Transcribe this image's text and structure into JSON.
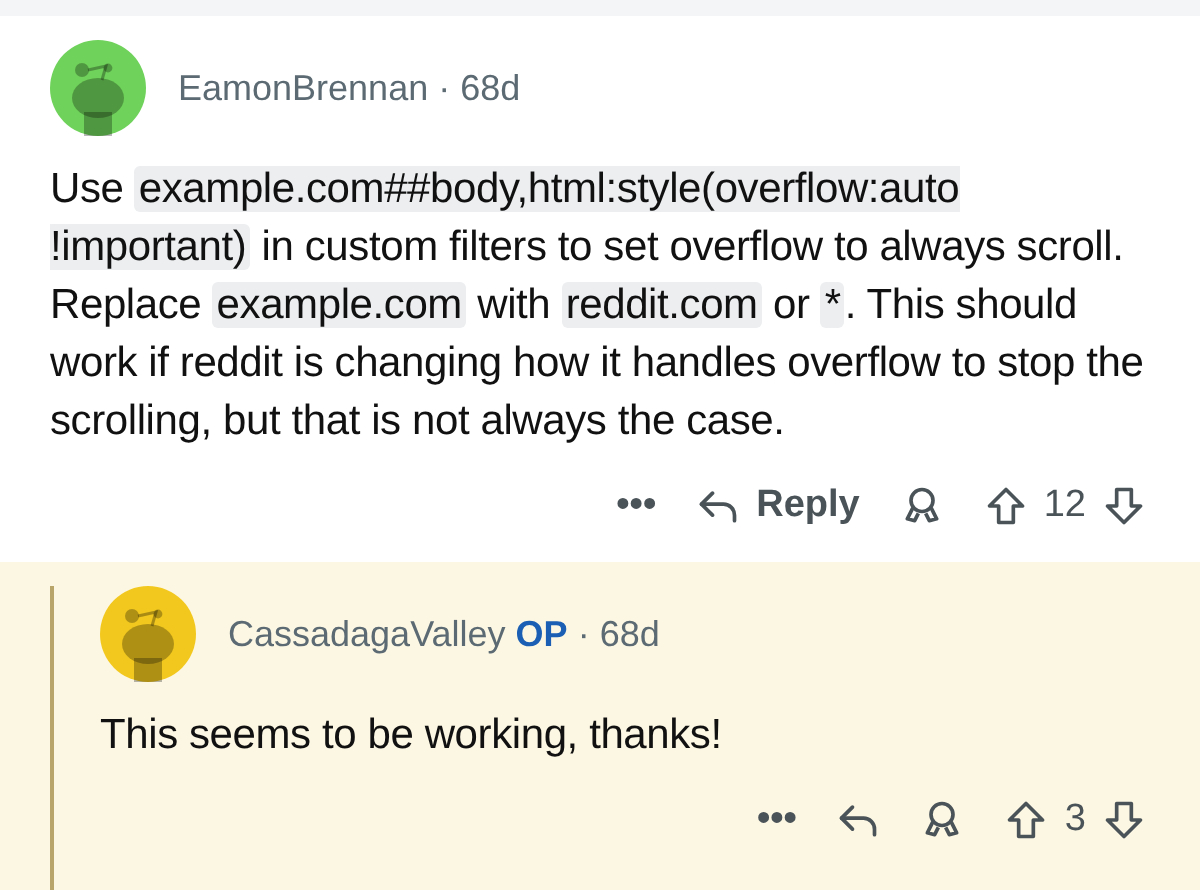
{
  "comments": [
    {
      "author": "EamonBrennan",
      "separator": "·",
      "age": "68d",
      "color": "#6fd25a",
      "highlighted": false,
      "body": [
        {
          "kind": "plain",
          "text": "Use "
        },
        {
          "kind": "code",
          "text": "example.com##body,html:style(overflow:auto !important)"
        },
        {
          "kind": "plain",
          "text": " in custom filters to set overflow to always scroll. Replace "
        },
        {
          "kind": "code",
          "text": "example.com"
        },
        {
          "kind": "plain",
          "text": " with "
        },
        {
          "kind": "code",
          "text": "reddit.com"
        },
        {
          "kind": "plain",
          "text": " or "
        },
        {
          "kind": "code",
          "text": "*"
        },
        {
          "kind": "plain",
          "text": ". This should work if reddit is changing how it handles overflow to stop the scrolling, but that is not always the case."
        }
      ],
      "more": "•••",
      "reply_label": "Reply",
      "score": "12"
    },
    {
      "author": "CassadagaValley",
      "op_label": "OP",
      "separator": "·",
      "age": "68d",
      "color": "#f2c81e",
      "highlighted": true,
      "body": [
        {
          "kind": "plain",
          "text": "This seems to be working, thanks!"
        }
      ],
      "more": "•••",
      "score": "3"
    }
  ]
}
